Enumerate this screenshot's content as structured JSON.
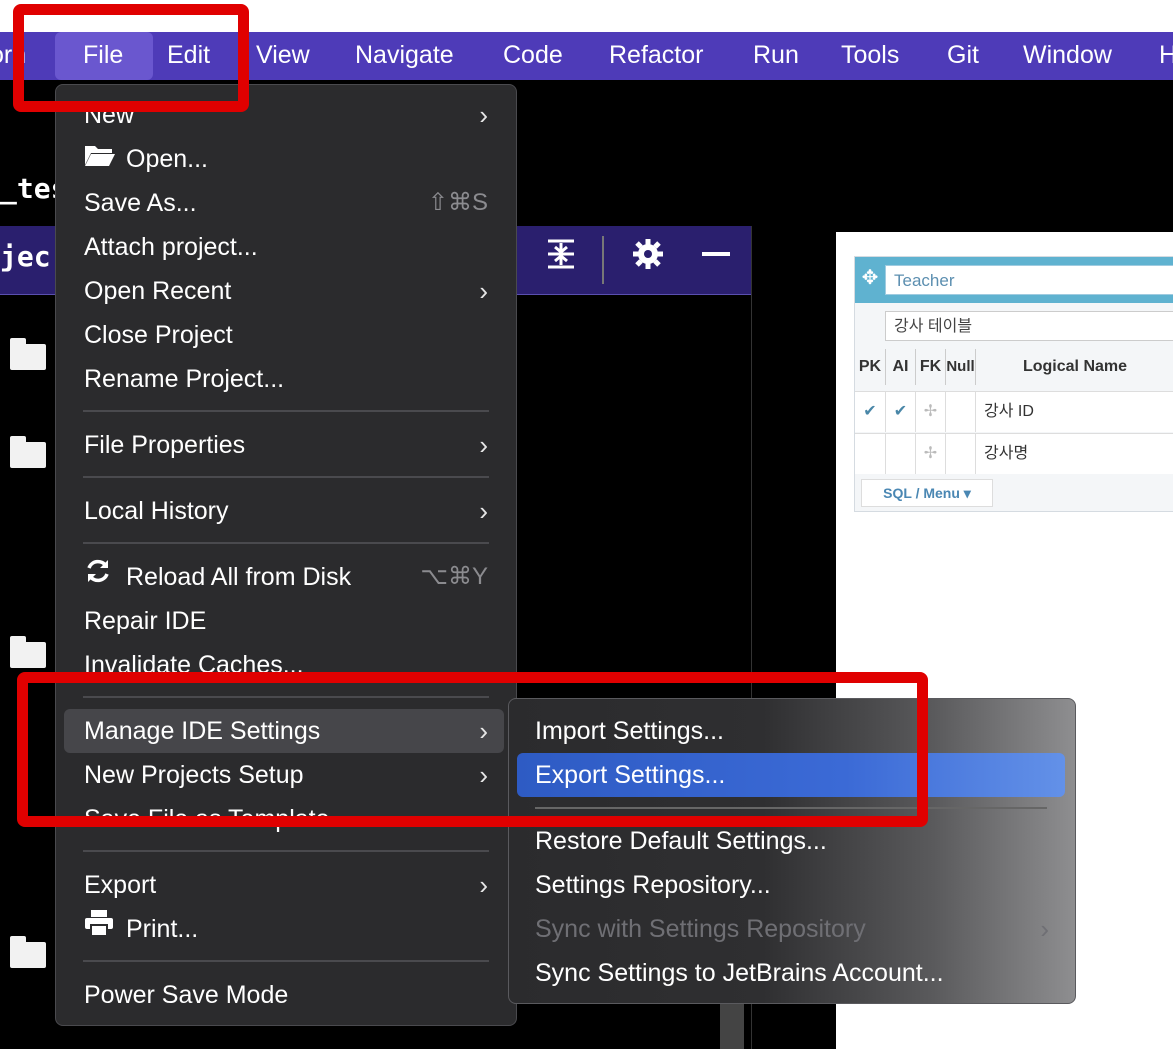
{
  "menubar": {
    "items": [
      "orn",
      "File",
      "Edit",
      "View",
      "Navigate",
      "Code",
      "Refactor",
      "Run",
      "Tools",
      "Git",
      "Window",
      "H"
    ]
  },
  "editor": {
    "test_fragment": "_tes",
    "project_fragment": "jec"
  },
  "file_menu": {
    "new": "New",
    "open": "Open...",
    "save_as": "Save As...",
    "save_as_shortcut": "⇧⌘S",
    "attach_project": "Attach project...",
    "open_recent": "Open Recent",
    "close_project": "Close Project",
    "rename_project": "Rename Project...",
    "file_properties": "File Properties",
    "local_history": "Local History",
    "reload_all": "Reload All from Disk",
    "reload_shortcut": "⌥⌘Y",
    "repair_ide": "Repair IDE",
    "invalidate_caches": "Invalidate Caches...",
    "manage_ide_settings": "Manage IDE Settings",
    "new_projects_setup": "New Projects Setup",
    "save_file_as_template": "Save File as Template...",
    "export": "Export",
    "print": "Print...",
    "power_save_mode": "Power Save Mode"
  },
  "submenu": {
    "import_settings": "Import Settings...",
    "export_settings": "Export Settings...",
    "restore_defaults": "Restore Default Settings...",
    "settings_repository": "Settings Repository...",
    "sync_with_repository": "Sync with Settings Repository",
    "sync_jetbrains": "Sync Settings to JetBrains Account..."
  },
  "erd": {
    "table_name": "Teacher",
    "table_comment": "강사 테이블",
    "headers": [
      "PK",
      "AI",
      "FK",
      "Null",
      "Logical Name"
    ],
    "rows": [
      {
        "pk": "✔",
        "ai": "✔",
        "fk": "✢",
        "null": "",
        "logical": "강사 ID"
      },
      {
        "pk": "",
        "ai": "",
        "fk": "✢",
        "null": "",
        "logical": "강사명"
      }
    ],
    "sql_menu": "SQL / Menu ▾"
  },
  "colors": {
    "menubar": "#4e3bb8",
    "menu_bg": "#2b2b2d",
    "selection_blue": "#2e5bc4",
    "annotation_red": "#e00000"
  }
}
